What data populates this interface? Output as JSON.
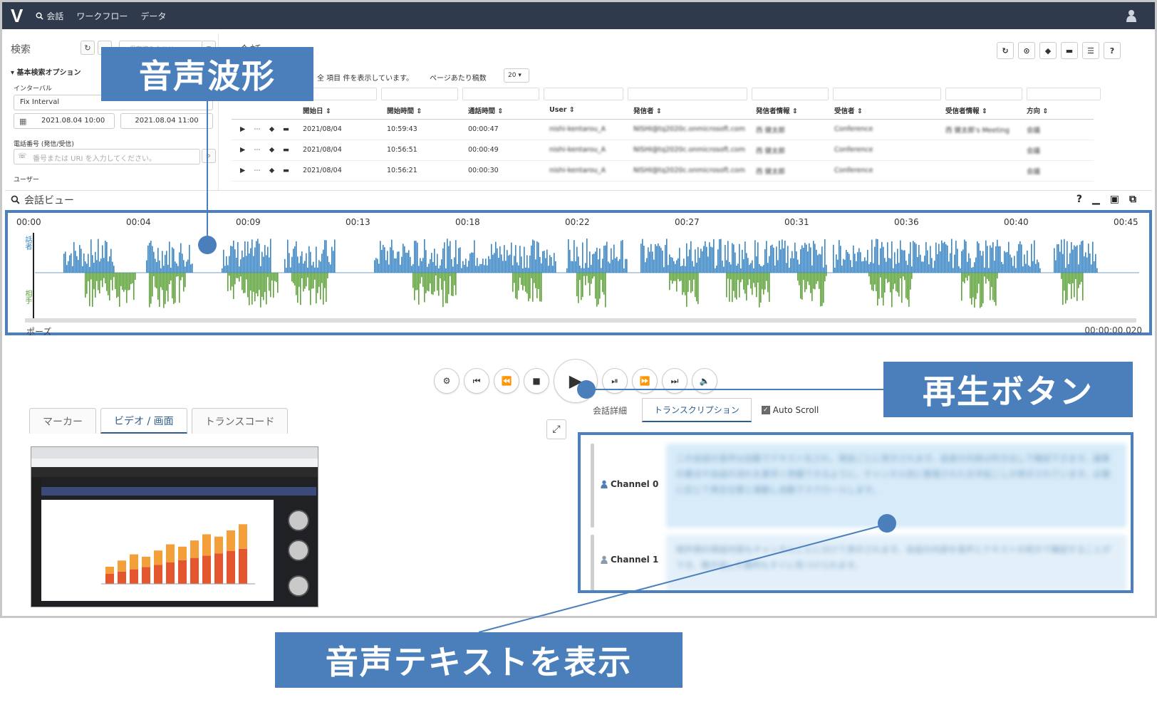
{
  "nav": {
    "logo": "V",
    "items": [
      "会話",
      "ワークフロー",
      "データ"
    ],
    "colors": {
      "bar": "#2f3b4c",
      "accent": "#4a7fbb"
    }
  },
  "search": {
    "title": "検索",
    "saved_search_placeholder": "<保存済みクエリ>",
    "basic_options": "基本検索オプション",
    "interval_label": "インターバル",
    "interval_value": "Fix Interval",
    "date_from": "2021.08.04 10:00",
    "date_to": "2021.08.04 11:00",
    "phone_label": "電話番号 (発信/受信)",
    "phone_placeholder": "番号または URI を入力してください。",
    "user_label": "ユーザー"
  },
  "calls": {
    "title": "会話",
    "count_text": "全 項目 件を表示しています。",
    "per_page_label": "ページあたり稿数",
    "per_page_value": "20",
    "columns": [
      "開始日",
      "開始時間",
      "通話時間",
      "User",
      "発信者",
      "発信者情報",
      "受信者",
      "受信者情報",
      "方向"
    ],
    "rows": [
      {
        "date": "2021/08/04",
        "start": "10:59:43",
        "duration": "00:00:47",
        "user": "nishi-kentarou_A",
        "caller": "NISHI@tq2020c.onmicrosoft.com",
        "caller_info": "西 健太郎",
        "callee": "Conference",
        "callee_info": "西 健太郎's Meeting",
        "direction": "会議"
      },
      {
        "date": "2021/08/04",
        "start": "10:56:51",
        "duration": "00:00:49",
        "user": "nishi-kentarou_A",
        "caller": "NISHI@tq2020c.onmicrosoft.com",
        "caller_info": "西 健太郎",
        "callee": "Conference",
        "callee_info": "",
        "direction": "会議"
      },
      {
        "date": "2021/08/04",
        "start": "10:56:21",
        "duration": "00:00:30",
        "user": "nishi-kentarou_A",
        "caller": "NISHI@tq2020c.onmicrosoft.com",
        "caller_info": "西 健太郎",
        "callee": "Conference",
        "callee_info": "",
        "direction": "会議"
      }
    ]
  },
  "conversation": {
    "title": "会話ビュー",
    "timeline": [
      "00:00",
      "00:04",
      "00:09",
      "00:13",
      "00:18",
      "00:22",
      "00:27",
      "00:31",
      "00:36",
      "00:40",
      "00:45"
    ],
    "channel_top_label": "話者",
    "channel_bottom_label": "相手",
    "pause_label": "ポーズ",
    "time_readout": "00:00:00.020",
    "wave_colors": {
      "channel0": "#3a86c4",
      "channel1": "#5ea33a"
    }
  },
  "player": {
    "buttons": [
      "settings",
      "skip-start",
      "rewind",
      "stop",
      "play",
      "step",
      "forward",
      "skip-end",
      "volume"
    ]
  },
  "left_tabs": [
    "マーカー",
    "ビデオ / 画面",
    "トランスコード"
  ],
  "right_tabs": [
    "会話詳細",
    "トランスクリプション"
  ],
  "auto_scroll": "Auto Scroll",
  "transcript": {
    "channels": [
      {
        "label": "Channel 0",
        "text": "この会話の音声は自動でテキスト化され、発話ごとに表示されます。話者の内容は吹き出しで確認できます。議事の要点や会話の流れを素早く把握できるように、チャンネル別に整理された文字起こしが表示されています。必要に応じて再生位置と連動し自動でスクロールします。"
      },
      {
        "label": "Channel 1",
        "text": "相手側の発話内容もチャンネルごとに分けて表示されます。会話の内容を音声とテキストの両方で確認することができ、聞き逃した箇所もすぐに見つけられます。"
      }
    ]
  },
  "callouts": {
    "waveform": "音声波形",
    "play_button": "再生ボタン",
    "transcript": "音声テキストを表示"
  }
}
